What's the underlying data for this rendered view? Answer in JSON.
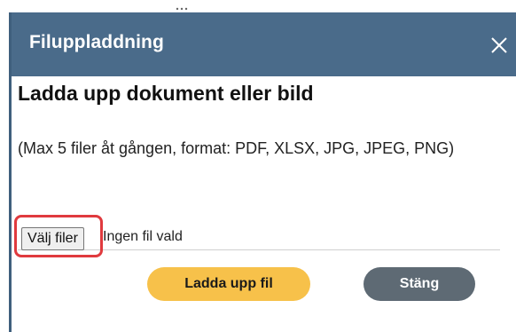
{
  "dialog": {
    "title": "Filuppladdning",
    "close_icon": "close-icon",
    "heading": "Ladda upp dokument eller bild",
    "info_text": "(Max 5 filer åt gången, format: PDF, XLSX, JPG, JPEG, PNG)",
    "file_input": {
      "button_label": "Välj filer",
      "status_text": "Ingen fil vald"
    },
    "upload_label": "Ladda upp fil",
    "close_label": "Stäng"
  },
  "colors": {
    "header_bg": "#4a6b8a",
    "upload_bg": "#f7c14a",
    "close_bg": "#5e6a74",
    "highlight": "#e03a3e"
  }
}
